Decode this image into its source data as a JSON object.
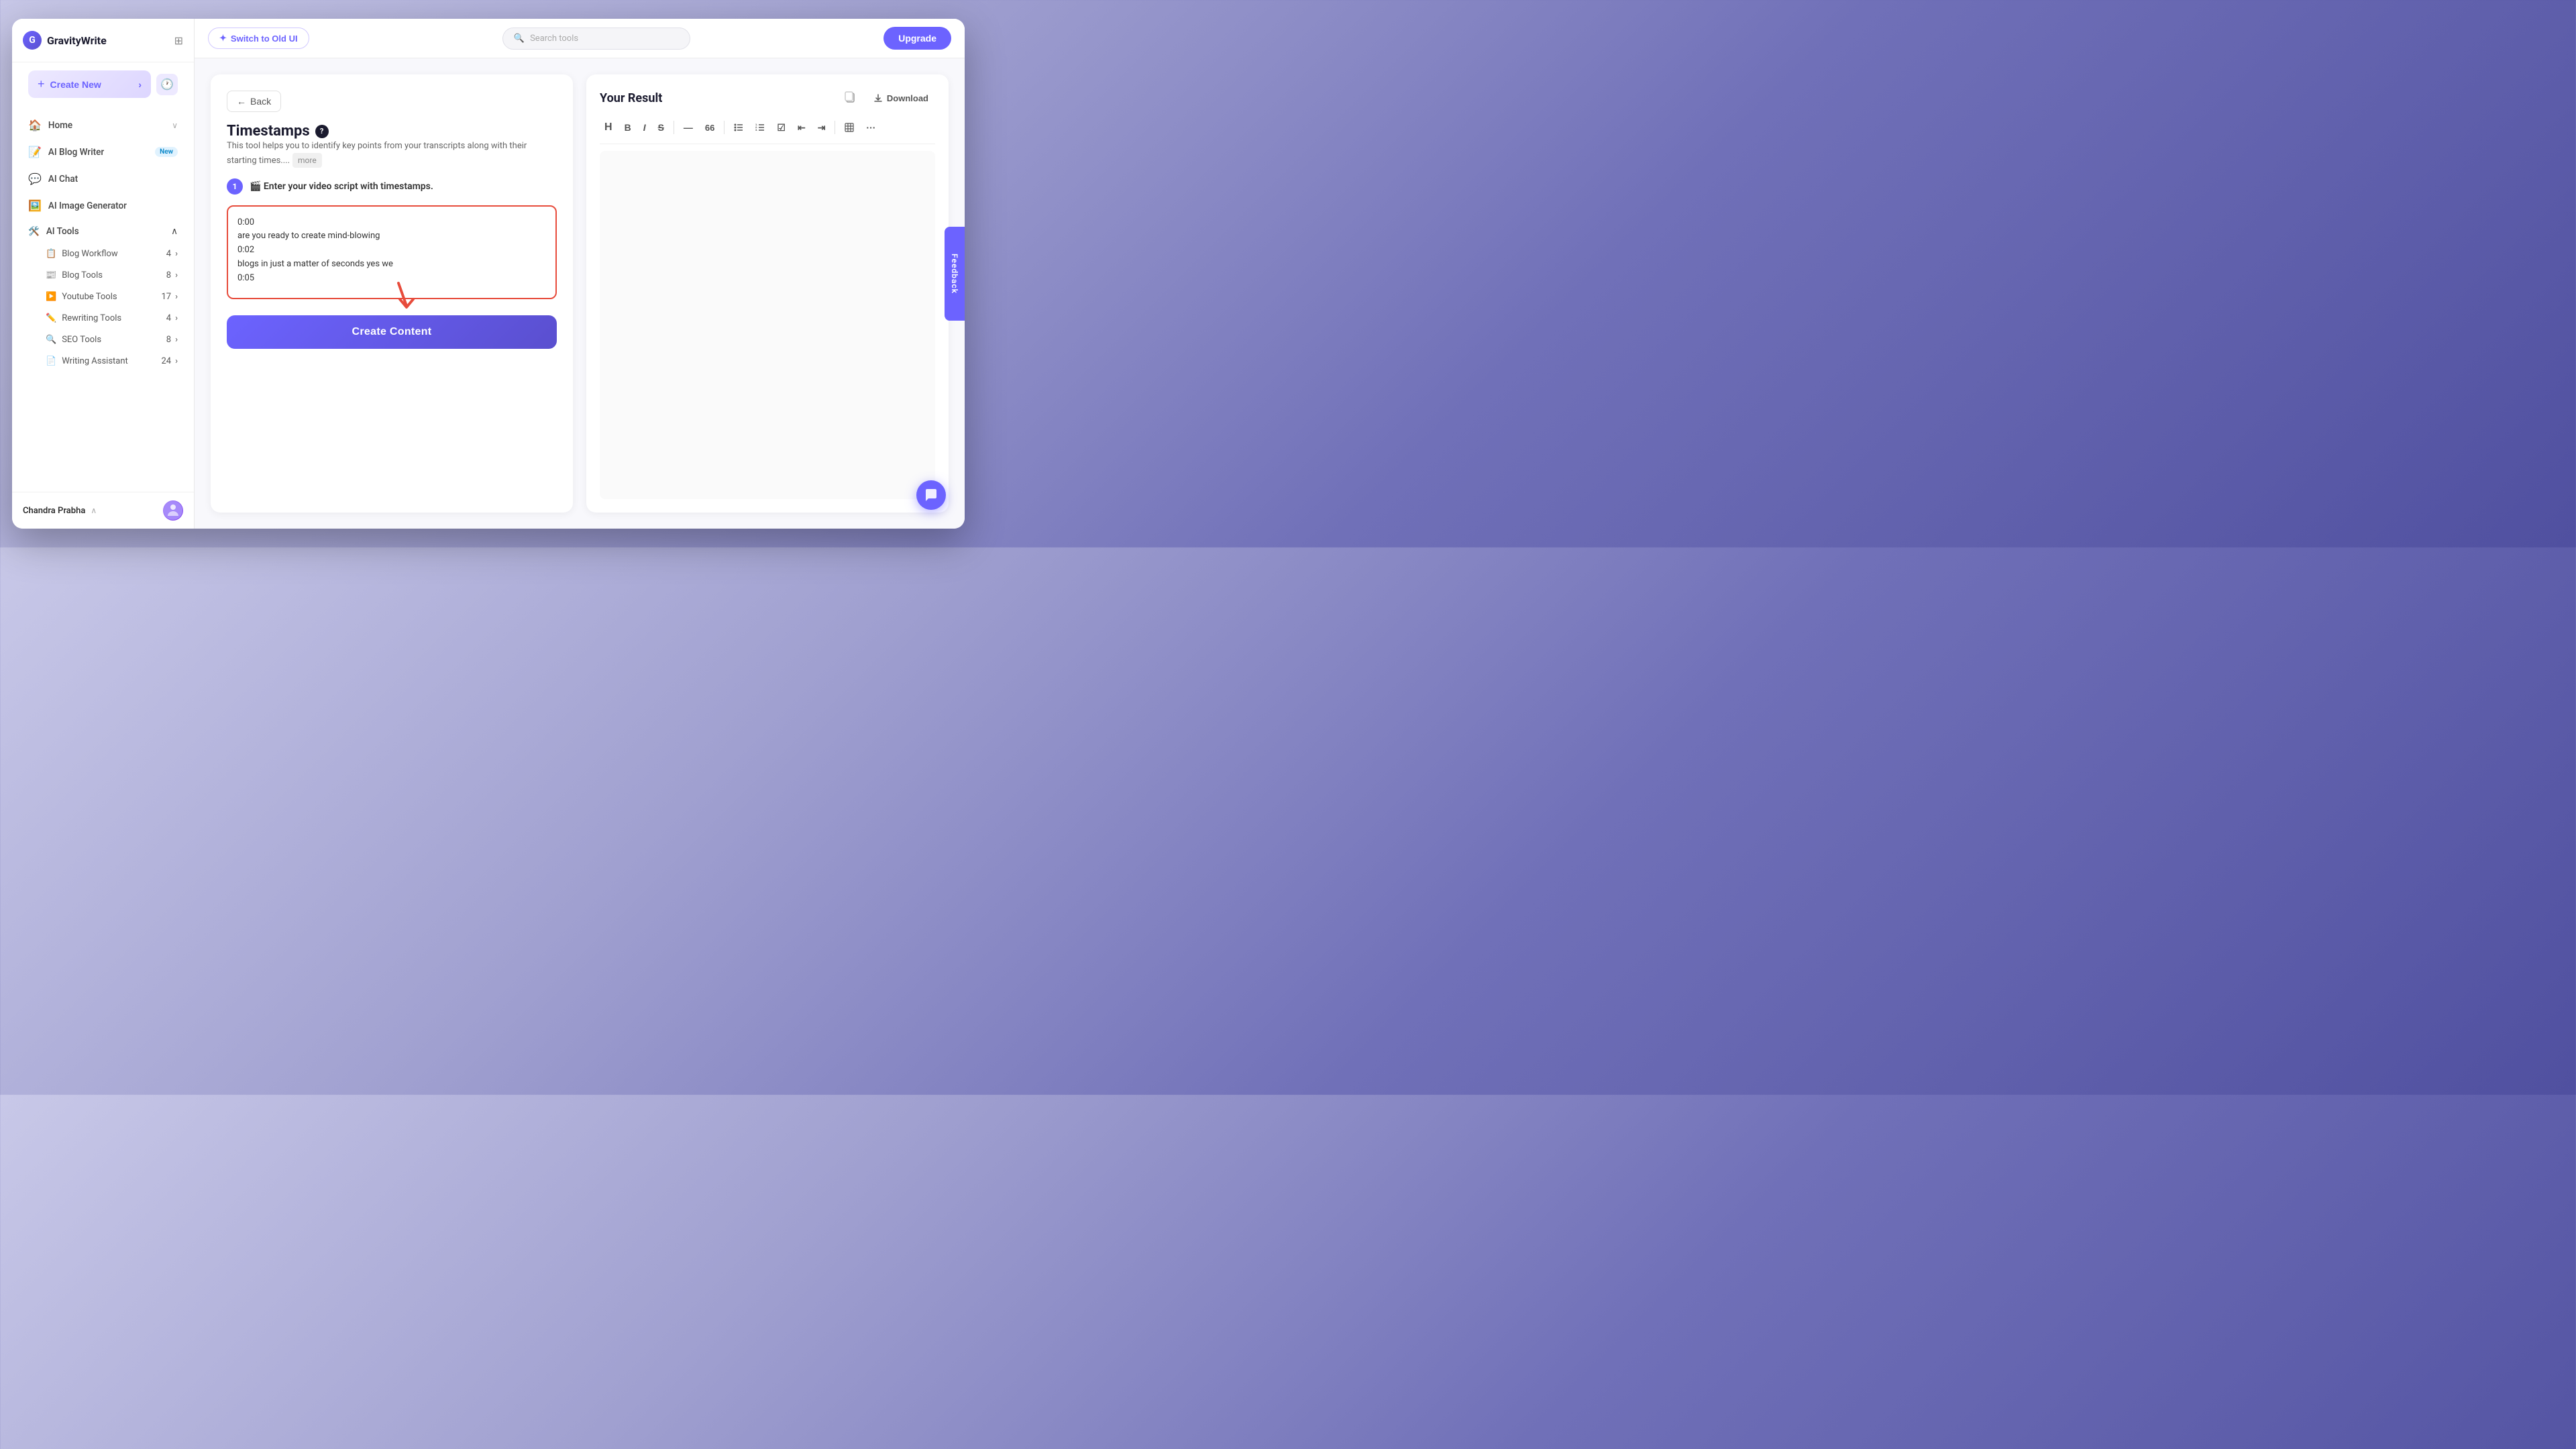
{
  "app": {
    "name": "GravityWrite"
  },
  "topbar": {
    "switch_label": "Switch to Old UI",
    "search_placeholder": "Search tools",
    "upgrade_label": "Upgrade"
  },
  "sidebar": {
    "create_new_label": "Create New",
    "nav_items": [
      {
        "id": "home",
        "icon": "🏠",
        "label": "Home",
        "badge": "",
        "expandable": true
      },
      {
        "id": "ai-blog-writer",
        "icon": "📝",
        "label": "AI Blog Writer",
        "badge": "New",
        "expandable": false
      },
      {
        "id": "ai-chat",
        "icon": "💬",
        "label": "AI Chat",
        "badge": "",
        "expandable": false
      },
      {
        "id": "ai-image-generator",
        "icon": "🖼️",
        "label": "AI Image Generator",
        "badge": "",
        "expandable": false
      }
    ],
    "ai_tools_label": "AI Tools",
    "sub_items": [
      {
        "id": "blog-workflow",
        "label": "Blog Workflow",
        "badge": "4",
        "expandable": true
      },
      {
        "id": "blog-tools",
        "label": "Blog Tools",
        "badge": "8",
        "expandable": true
      },
      {
        "id": "youtube-tools",
        "label": "Youtube Tools",
        "badge": "17",
        "expandable": true
      },
      {
        "id": "rewriting-tools",
        "label": "Rewriting Tools",
        "badge": "4",
        "expandable": true
      },
      {
        "id": "seo-tools",
        "label": "SEO Tools",
        "badge": "8",
        "expandable": true
      },
      {
        "id": "writing-assistant",
        "label": "Writing Assistant",
        "badge": "24",
        "expandable": true
      }
    ],
    "user_name": "Chandra Prabha"
  },
  "tool": {
    "back_label": "Back",
    "title": "Timestamps",
    "description": "This tool helps you to identify key points from your transcripts along with their starting times....",
    "more_label": "more",
    "step_number": "1",
    "step_label": "🎬 Enter your video script with timestamps.",
    "script_content": "0:00\nare you ready to create mind-blowing\n0:02\nblogs in just a matter of seconds yes we\n0:05",
    "create_content_label": "Create Content"
  },
  "result": {
    "title": "Your Result",
    "download_label": "Download",
    "toolbar": [
      {
        "id": "heading",
        "label": "H"
      },
      {
        "id": "bold",
        "label": "B"
      },
      {
        "id": "italic",
        "label": "I"
      },
      {
        "id": "strikethrough",
        "label": "S"
      },
      {
        "id": "divider1",
        "type": "separator"
      },
      {
        "id": "hr",
        "label": "—"
      },
      {
        "id": "quote",
        "label": "66"
      },
      {
        "id": "divider2",
        "type": "separator"
      },
      {
        "id": "bullet-list",
        "label": "☰"
      },
      {
        "id": "ordered-list",
        "label": "≡"
      },
      {
        "id": "checklist",
        "label": "☑"
      },
      {
        "id": "indent-out",
        "label": "⇤"
      },
      {
        "id": "indent-in",
        "label": "⇥"
      },
      {
        "id": "divider3",
        "type": "separator"
      },
      {
        "id": "table",
        "label": "⊞"
      },
      {
        "id": "more",
        "label": "···"
      }
    ]
  },
  "feedback": {
    "label": "Feedback"
  }
}
